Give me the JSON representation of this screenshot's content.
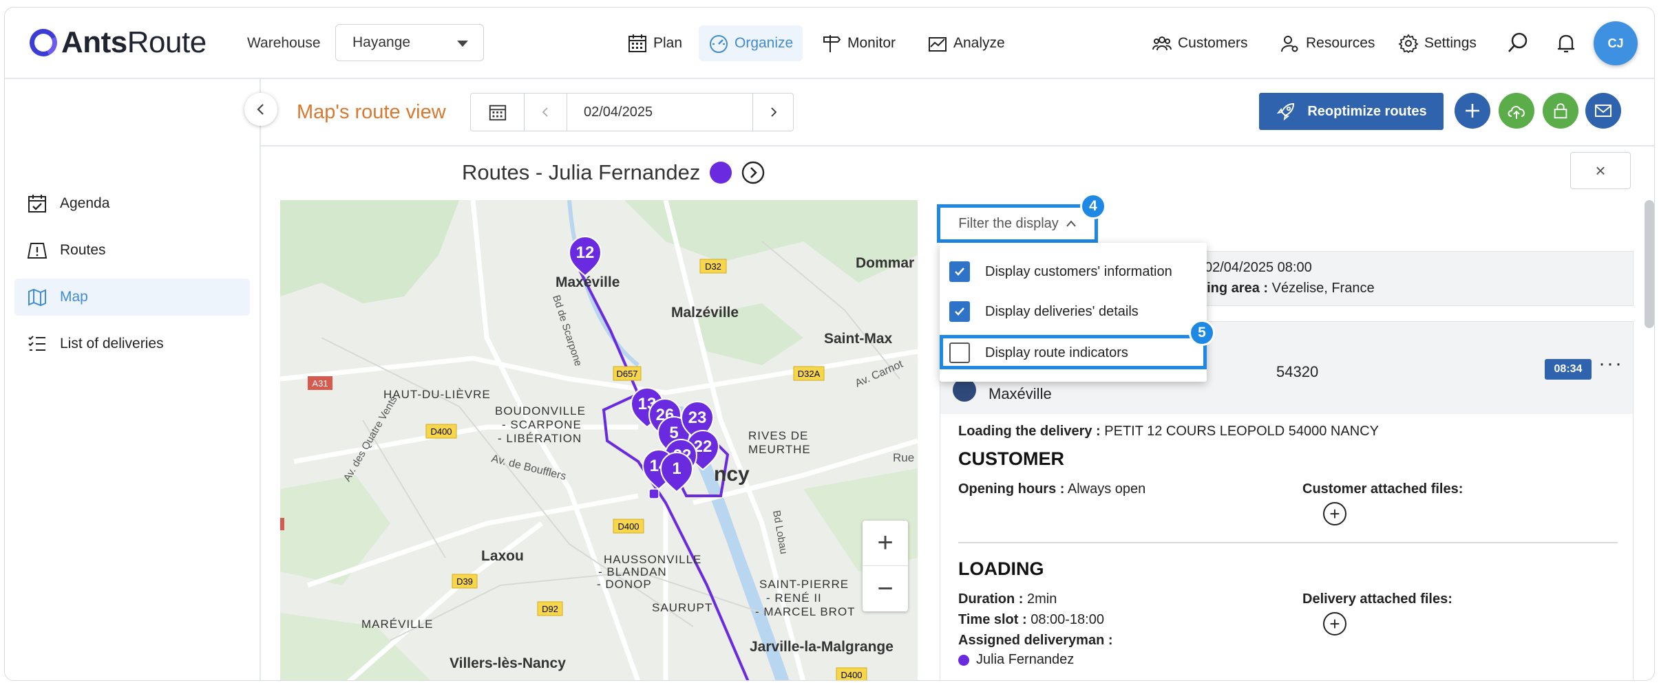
{
  "app": {
    "logo_bold": "Ants",
    "logo_light": "Route"
  },
  "topbar": {
    "warehouse_label": "Warehouse",
    "warehouse_value": "Hayange",
    "nav": [
      {
        "label": "Plan",
        "icon": "calendar-icon"
      },
      {
        "label": "Organize",
        "icon": "gauge-icon",
        "active": true
      },
      {
        "label": "Monitor",
        "icon": "signpost-icon"
      },
      {
        "label": "Analyze",
        "icon": "chart-icon"
      }
    ],
    "right_nav": [
      {
        "label": "Customers",
        "icon": "users-icon"
      },
      {
        "label": "Resources",
        "icon": "user-gear-icon"
      },
      {
        "label": "Settings",
        "icon": "gear-icon"
      }
    ],
    "avatar_initials": "CJ"
  },
  "sidebar": {
    "items": [
      {
        "label": "Agenda",
        "icon": "calendar-check-icon"
      },
      {
        "label": "Routes",
        "icon": "warning-road-icon"
      },
      {
        "label": "Map",
        "icon": "map-icon",
        "active": true
      },
      {
        "label": "List of deliveries",
        "icon": "list-icon"
      }
    ]
  },
  "subheader": {
    "title": "Map's route view",
    "date": "02/04/2025",
    "reoptimize_label": "Reoptimize routes"
  },
  "routes": {
    "title": "Routes - Julia Fernandez",
    "color": "#6a2be0",
    "close": "×"
  },
  "map": {
    "labels": [
      {
        "text": "Maxéville",
        "bold": true
      },
      {
        "text": "Malzéville",
        "bold": true
      },
      {
        "text": "Dommar",
        "bold": true
      },
      {
        "text": "Saint-Max",
        "bold": true
      },
      {
        "text": "HAUT-DU-LIÈVRE"
      },
      {
        "text": "BOUDONVILLE"
      },
      {
        "text": "- SCARPONE"
      },
      {
        "text": "- LIBÉRATION"
      },
      {
        "text": "RIVES DE"
      },
      {
        "text": "MEURTHE"
      },
      {
        "text": "ncy",
        "bold": true
      },
      {
        "text": "Laxou",
        "bold": true
      },
      {
        "text": "HAUSSONVILLE"
      },
      {
        "text": "- BLANDAN"
      },
      {
        "text": "- DONOP"
      },
      {
        "text": "SAURUPT"
      },
      {
        "text": "SAINT-PIERRE"
      },
      {
        "text": "- RENÉ II"
      },
      {
        "text": "- MARCEL BROT"
      },
      {
        "text": "MARÉVILLE"
      },
      {
        "text": "Villers-lès-Nancy",
        "bold": true
      },
      {
        "text": "Jarville-la-Malgrange",
        "bold": true
      },
      {
        "text": "Bd de Scarpone"
      },
      {
        "text": "Av. de Boufflers"
      },
      {
        "text": "Av. Carnot"
      },
      {
        "text": "Bd Lobau"
      },
      {
        "text": "Av. des Quatre Vents"
      },
      {
        "text": "Rue"
      }
    ],
    "shields": [
      "D32",
      "D657",
      "D32A",
      "A31",
      "D400",
      "D400",
      "D39",
      "D92",
      "D400"
    ],
    "markers": [
      "12",
      "13",
      "26",
      "5",
      "23",
      "22",
      "14",
      "1"
    ],
    "zoom_in": "+",
    "zoom_out": "−"
  },
  "filter": {
    "button_label": "Filter the display",
    "badge_button": "4",
    "badge_option": "5",
    "options": [
      {
        "label": "Display customers' information",
        "checked": true
      },
      {
        "label": "Display deliveries' details",
        "checked": true
      },
      {
        "label": "Display route indicators",
        "checked": false
      }
    ]
  },
  "info": {
    "start_fragment": "02/04/2025 08:00",
    "area_label": "king area :",
    "area_value": "Vézelise, France"
  },
  "delivery": {
    "postcode_fragment": "54320",
    "city": "Maxéville",
    "time": "08:34",
    "more": "···",
    "loading_label": "Loading the delivery :",
    "loading_value": "PETIT 12 COURS LEOPOLD 54000 NANCY",
    "customer_title": "CUSTOMER",
    "opening_label": "Opening hours :",
    "opening_value": "Always open",
    "customer_files_label": "Customer attached files:",
    "loading_title": "LOADING",
    "duration_label": "Duration :",
    "duration_value": "2min",
    "slot_label": "Time slot :",
    "slot_value": "08:00-18:00",
    "assigned_label": "Assigned deliveryman :",
    "assigned_value": "Julia Fernandez",
    "delivery_files_label": "Delivery attached files:"
  }
}
